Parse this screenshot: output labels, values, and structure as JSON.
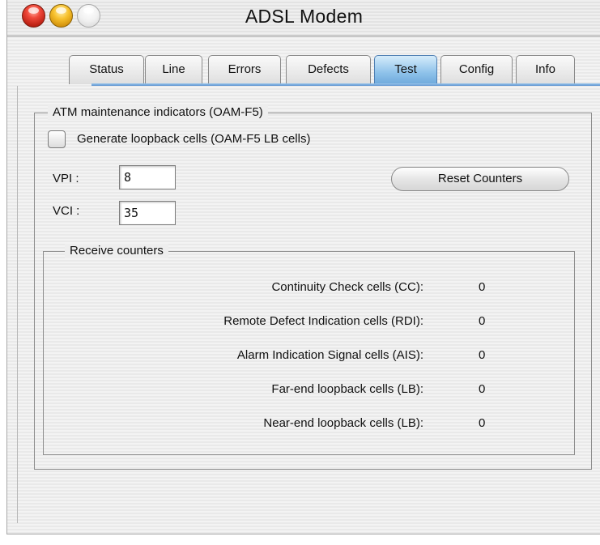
{
  "window": {
    "title": "ADSL Modem"
  },
  "tabs": [
    {
      "label": "Status"
    },
    {
      "label": "Line"
    },
    {
      "label": "Errors"
    },
    {
      "label": "Defects"
    },
    {
      "label": "Test",
      "active": true
    },
    {
      "label": "Config"
    },
    {
      "label": "Info"
    }
  ],
  "atm_group": {
    "title": "ATM maintenance indicators (OAM-F5)",
    "generate_checkbox_label": "Generate loopback cells (OAM-F5 LB cells)",
    "generate_checked": false,
    "vpi_label": "VPI :",
    "vpi_value": "8",
    "vci_label": "VCI :",
    "vci_value": "35",
    "reset_button_label": "Reset Counters"
  },
  "receive_counters": {
    "title": "Receive counters",
    "rows": [
      {
        "label": "Continuity Check cells (CC):",
        "value": "0"
      },
      {
        "label": "Remote Defect Indication cells (RDI):",
        "value": "0"
      },
      {
        "label": "Alarm Indication Signal cells (AIS):",
        "value": "0"
      },
      {
        "label": "Far-end loopback cells (LB):",
        "value": "0"
      },
      {
        "label": "Near-end loopback cells (LB):",
        "value": "0"
      }
    ]
  }
}
